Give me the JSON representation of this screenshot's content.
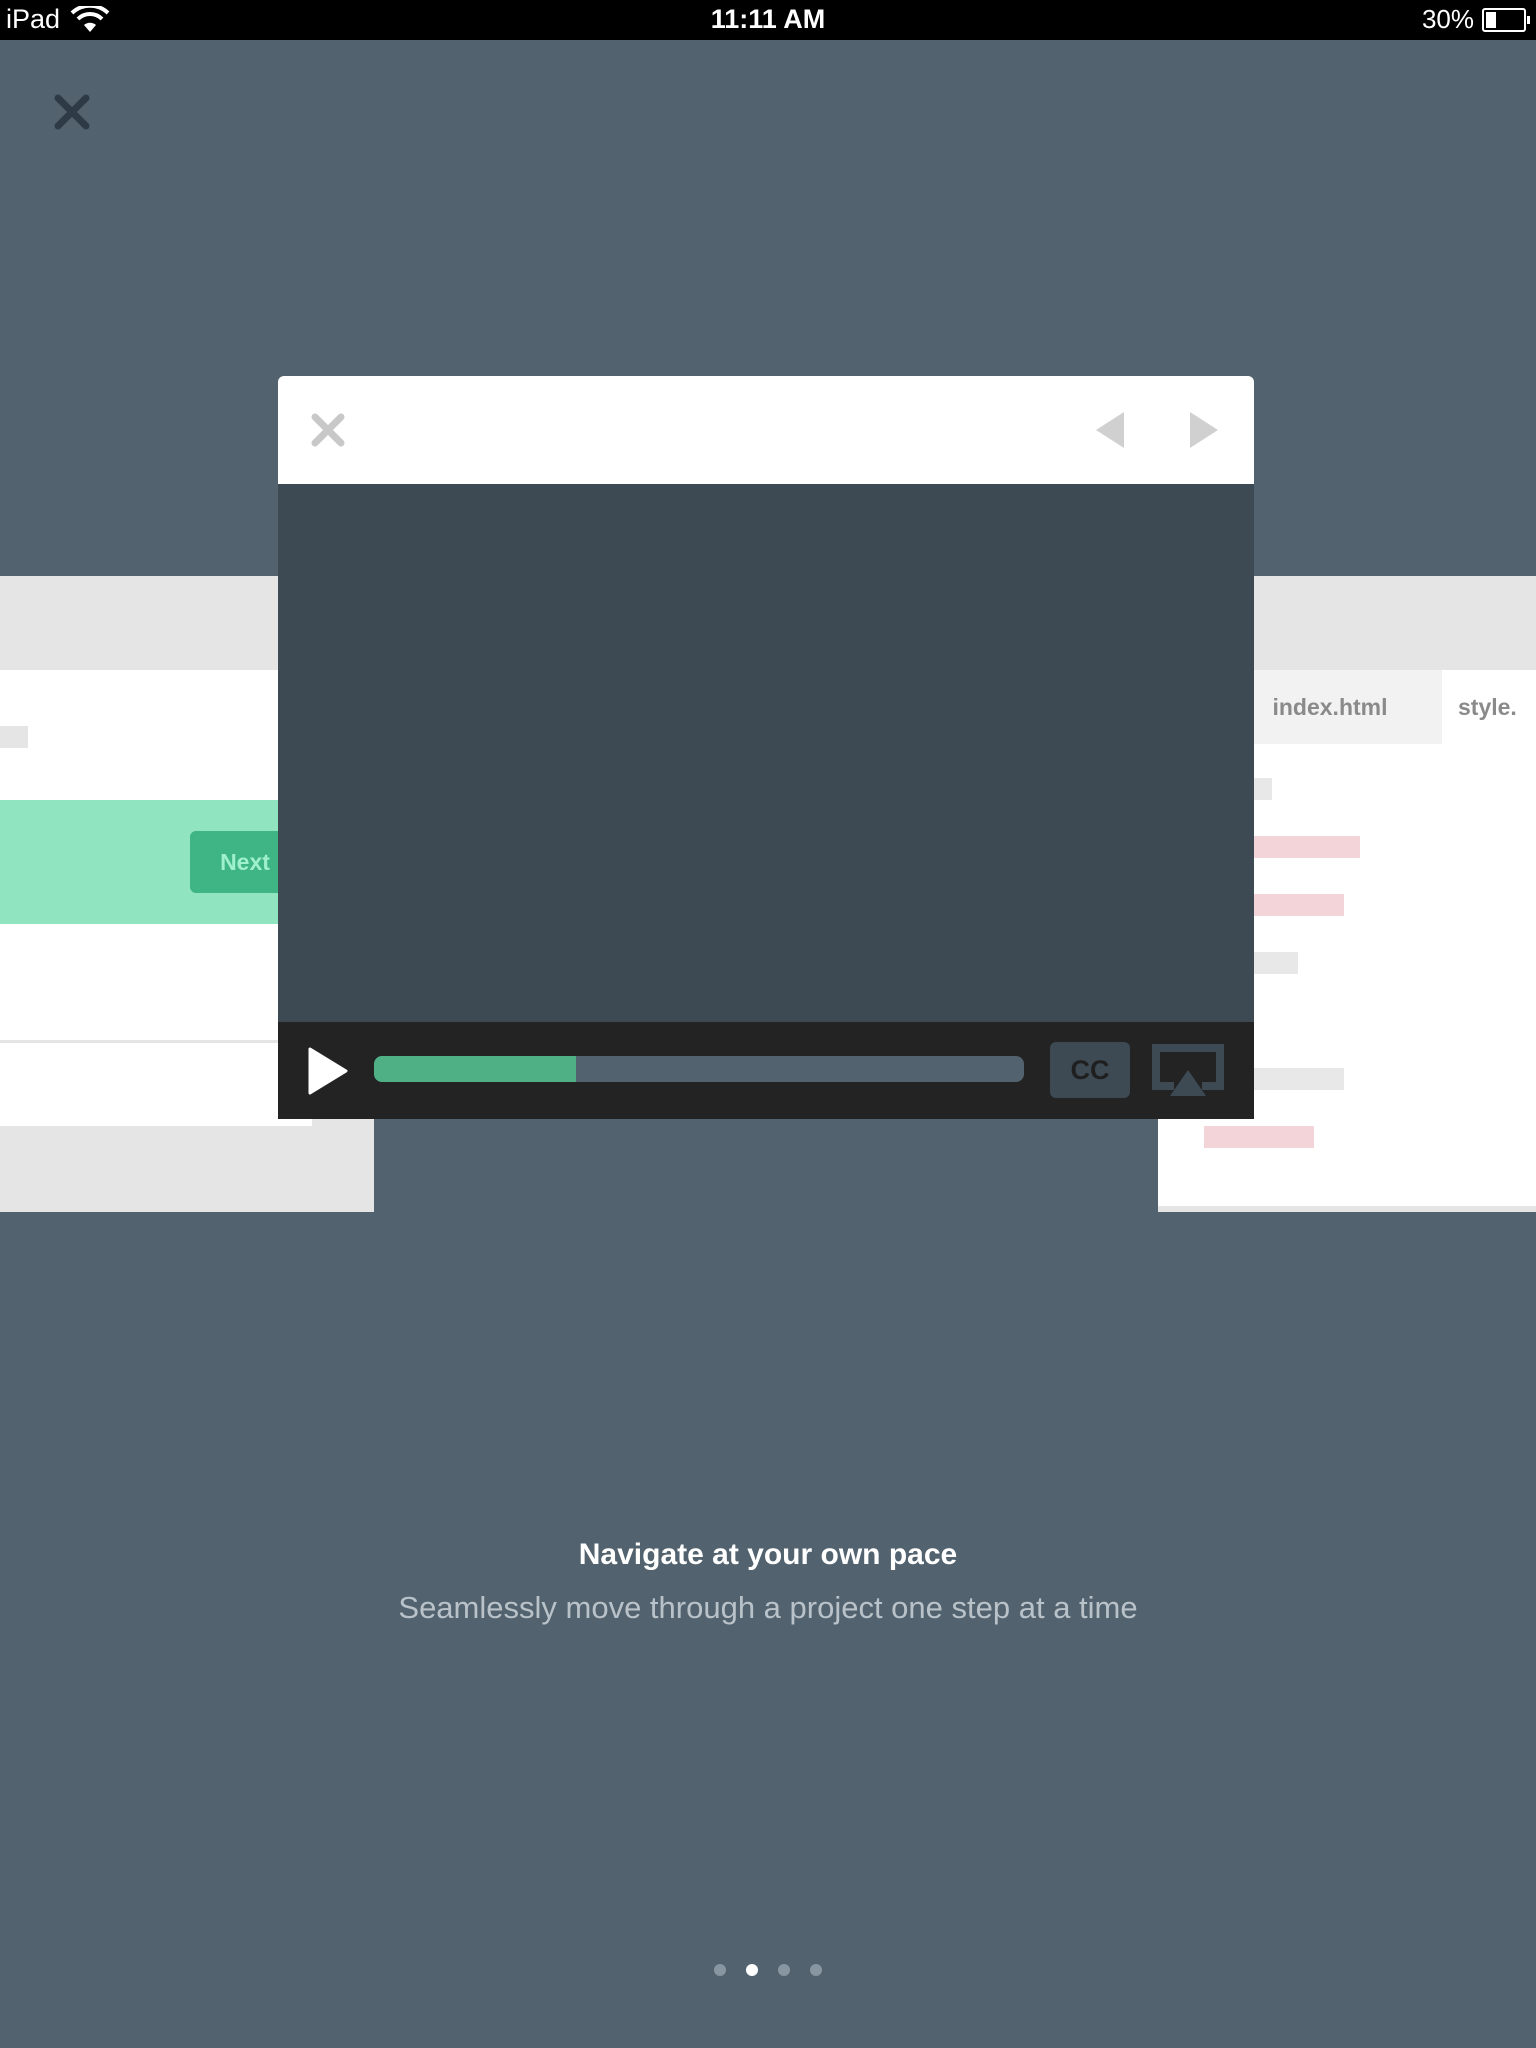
{
  "status_bar": {
    "carrier": "iPad",
    "time": "11:11 AM",
    "battery": "30%",
    "battery_level": 0.3
  },
  "background_mock": {
    "left_panel": {
      "next_label": "Next"
    },
    "right_panel": {
      "tab_1": "index.html",
      "tab_2": "style."
    }
  },
  "modal": {
    "close_icon": "close-icon",
    "prev_icon": "arrow-left-icon",
    "next_icon": "arrow-right-icon",
    "player": {
      "play_icon": "play-icon",
      "progress_fraction": 0.31,
      "cc_label": "CC",
      "airplay_icon": "airplay-icon"
    }
  },
  "caption": {
    "title": "Navigate at your own pace",
    "subtitle": "Seamlessly move through a project one step at a time"
  },
  "pagination": {
    "count": 4,
    "active_index": 1
  },
  "colors": {
    "background": "#52636f",
    "accent_green": "#50b085",
    "video_bg": "#3d4a54",
    "controls_bg": "#232323"
  }
}
